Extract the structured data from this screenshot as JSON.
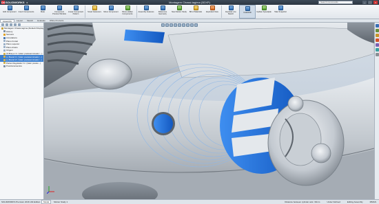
{
  "app": {
    "logo_text": "SOLIDWORKS",
    "window_title": "Montagem Chassi-tagima (3DXP)",
    "search_placeholder": "Search Commands"
  },
  "ribbon": {
    "buttons": [
      {
        "label": "Edit Component",
        "color": "blue"
      },
      {
        "label": "Insert Components",
        "color": "blue"
      },
      {
        "label": "Mate",
        "color": "blue"
      },
      {
        "label": "Component Preview Window",
        "color": "blue"
      },
      {
        "label": "Linear Component Pattern",
        "color": "blue"
      },
      {
        "label": "Smart Fasteners",
        "color": "yellow"
      },
      {
        "label": "Move Component",
        "color": "blue"
      },
      {
        "label": "Show Hidden Components",
        "color": "green"
      },
      {
        "label": "Assembly Features",
        "color": "blue"
      },
      {
        "label": "Reference Geometry",
        "color": "blue"
      },
      {
        "label": "New Motion Study",
        "color": "green"
      },
      {
        "label": "Bill of Materials",
        "color": "yellow"
      },
      {
        "label": "Exploded View",
        "color": "orange"
      },
      {
        "label": "Explode Line Sketch",
        "color": "blue"
      },
      {
        "label": "Instant3D",
        "color": "blue"
      },
      {
        "label": "Update Speedpak",
        "color": "green"
      },
      {
        "label": "Take Snapshot",
        "color": "blue"
      }
    ]
  },
  "tabs": [
    "Assembly",
    "Layout",
    "Sketch",
    "Evaluate",
    "Office Products"
  ],
  "tree": [
    {
      "label": "Montagem Chassi-tagima (Default<Display State-1>)",
      "icon_color": "#c9a23a",
      "selected": false,
      "indent": 0
    },
    {
      "label": "History",
      "icon_color": "#7e8fa3",
      "selected": false,
      "indent": 1
    },
    {
      "label": "Sensors",
      "icon_color": "#e0a020",
      "selected": false,
      "indent": 1
    },
    {
      "label": "Annotations",
      "icon_color": "#4a78b0",
      "selected": false,
      "indent": 1
    },
    {
      "label": "Plano frontal",
      "icon_color": "#9ab0c7",
      "selected": false,
      "indent": 1
    },
    {
      "label": "Plano superior",
      "icon_color": "#9ab0c7",
      "selected": false,
      "indent": 1
    },
    {
      "label": "Plano direito",
      "icon_color": "#9ab0c7",
      "selected": false,
      "indent": 1
    },
    {
      "label": "Origem",
      "icon_color": "#9ab0c7",
      "selected": false,
      "indent": 1
    },
    {
      "label": "(f) Braço<1> (Valor predeterminado<...)",
      "icon_color": "#d6b24a",
      "selected": false,
      "indent": 1
    },
    {
      "label": "(-) Bocal<1> (Valor predeterminado<...)",
      "icon_color": "#d6b24a",
      "selected": true,
      "indent": 1
    },
    {
      "label": "(-) Bocal<2> (Valor predeterminado<...)",
      "icon_color": "#d6b24a",
      "selected": true,
      "indent": 1
    },
    {
      "label": "Partes Regulador<1> (Valor predet...)",
      "icon_color": "#d6b24a",
      "selected": false,
      "indent": 1
    },
    {
      "label": "Posicionamentos",
      "icon_color": "#7e8fa3",
      "selected": false,
      "indent": 1
    }
  ],
  "status": {
    "app_name": "SOLIDWORKS Premium 2016 x64 Edition",
    "model_tab": "Model",
    "motion_tab": "Motion Study 1",
    "measure": "Distance between cylinder axis: 33mm",
    "state": "Under Defined",
    "mode": "Editing Assembly",
    "units": "MMGS"
  },
  "colors": {
    "highlight": "#1f6fd6",
    "body_gray": "#c6ccd3"
  }
}
